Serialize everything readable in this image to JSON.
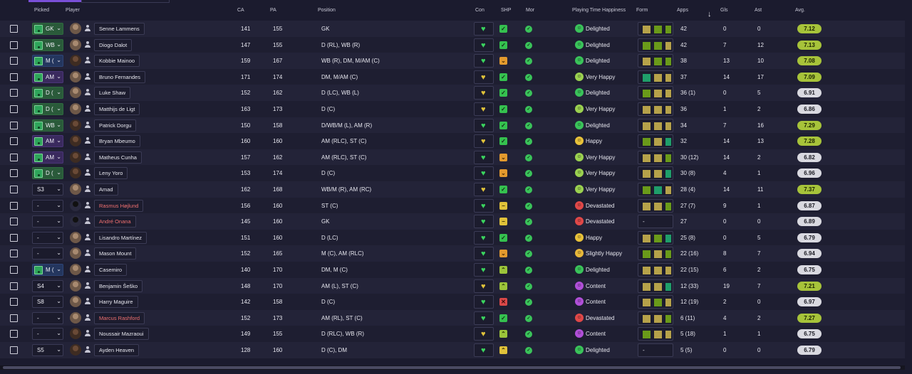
{
  "headers": {
    "picked": "Picked",
    "player": "Player",
    "ca": "CA",
    "pa": "PA",
    "position": "Position",
    "con": "Con",
    "shp": "SHP",
    "mor": "Mor",
    "pth": "Playing Time Happiness",
    "form": "Form",
    "apps": "Apps",
    "gls": "Gls",
    "ast": "Ast",
    "avg": "Avg."
  },
  "icons": {
    "checkbox": "checkbox-icon",
    "pitch": "pitch-icon",
    "chevron": "chevron-down-icon",
    "person": "person-icon",
    "heart": "heart-icon",
    "sort": "arrow-down-icon",
    "morale": "morale-icon"
  },
  "colors": {
    "accent": "#7a4fd8",
    "rating_high": "#a7c33a",
    "rating_low": "#d9d9e0",
    "negative_name": "#f07070"
  },
  "rows": [
    {
      "picked": "GK",
      "pk": "green",
      "avatar": "light",
      "name": "Senne Lammens",
      "red": false,
      "ca": "141",
      "pa": "155",
      "position": "GK",
      "con": "green",
      "shp": "green",
      "shp_g": "✓",
      "mor": "green",
      "hap": "Delighted",
      "hap_c": "g",
      "form": [
        "olive",
        "green",
        "green"
      ],
      "apps": "42",
      "gls": "0",
      "ast": "0",
      "avg": "7.12",
      "avg_hi": true
    },
    {
      "picked": "WB",
      "pk": "green",
      "avatar": "light",
      "name": "Diogo Dalot",
      "red": false,
      "ca": "147",
      "pa": "155",
      "position": "D (RL), WB (R)",
      "con": "green",
      "shp": "green",
      "shp_g": "✓",
      "mor": "green",
      "hap": "Delighted",
      "hap_c": "g",
      "form": [
        "green",
        "green",
        "olive"
      ],
      "apps": "42",
      "gls": "7",
      "ast": "12",
      "avg": "7.13",
      "avg_hi": true
    },
    {
      "picked": "M (",
      "pk": "blue",
      "avatar": "dark",
      "name": "Kobbie Mainoo",
      "red": false,
      "ca": "159",
      "pa": "167",
      "position": "WB (R), DM, M/AM (C)",
      "con": "green",
      "shp": "orange",
      "shp_g": "⌄",
      "mor": "green",
      "hap": "Delighted",
      "hap_c": "g",
      "form": [
        "olive",
        "green",
        "green"
      ],
      "apps": "38",
      "gls": "13",
      "ast": "10",
      "avg": "7.08",
      "avg_hi": true
    },
    {
      "picked": "AM",
      "pk": "purple",
      "avatar": "light",
      "name": "Bruno Fernandes",
      "red": false,
      "ca": "171",
      "pa": "174",
      "position": "DM, M/AM (C)",
      "con": "yellow",
      "shp": "green",
      "shp_g": "✓",
      "mor": "green",
      "hap": "Very Happy",
      "hap_c": "lg",
      "form": [
        "teal",
        "olive",
        "olive"
      ],
      "apps": "37",
      "gls": "14",
      "ast": "17",
      "avg": "7.09",
      "avg_hi": true
    },
    {
      "picked": "D (",
      "pk": "green",
      "avatar": "light",
      "name": "Luke Shaw",
      "red": false,
      "ca": "152",
      "pa": "162",
      "position": "D (LC), WB (L)",
      "con": "yellow",
      "shp": "green",
      "shp_g": "✓",
      "mor": "green",
      "hap": "Delighted",
      "hap_c": "g",
      "form": [
        "green",
        "olive",
        "olive"
      ],
      "apps": "36 (1)",
      "gls": "0",
      "ast": "5",
      "avg": "6.91",
      "avg_hi": false
    },
    {
      "picked": "D (",
      "pk": "green",
      "avatar": "light",
      "name": "Matthijs de Ligt",
      "red": false,
      "ca": "163",
      "pa": "173",
      "position": "D (C)",
      "con": "yellow",
      "shp": "green",
      "shp_g": "✓",
      "mor": "green",
      "hap": "Very Happy",
      "hap_c": "lg",
      "form": [
        "olive",
        "olive",
        "olive"
      ],
      "apps": "36",
      "gls": "1",
      "ast": "2",
      "avg": "6.86",
      "avg_hi": false
    },
    {
      "picked": "WB",
      "pk": "green",
      "avatar": "dark",
      "name": "Patrick Dorgu",
      "red": false,
      "ca": "150",
      "pa": "158",
      "position": "D/WB/M (L), AM (R)",
      "con": "green",
      "shp": "green",
      "shp_g": "✓",
      "mor": "green",
      "hap": "Delighted",
      "hap_c": "g",
      "form": [
        "olive",
        "olive",
        "olive"
      ],
      "apps": "34",
      "gls": "7",
      "ast": "16",
      "avg": "7.29",
      "avg_hi": true
    },
    {
      "picked": "AM",
      "pk": "purple",
      "avatar": "dark",
      "name": "Bryan Mbeumo",
      "red": false,
      "ca": "160",
      "pa": "160",
      "position": "AM (RLC), ST (C)",
      "con": "yellow",
      "shp": "green",
      "shp_g": "✓",
      "mor": "green",
      "hap": "Happy",
      "hap_c": "y",
      "form": [
        "green",
        "olive",
        "teal"
      ],
      "apps": "32",
      "gls": "14",
      "ast": "13",
      "avg": "7.28",
      "avg_hi": true
    },
    {
      "picked": "AM",
      "pk": "purple",
      "avatar": "dark",
      "name": "Matheus Cunha",
      "red": false,
      "ca": "157",
      "pa": "162",
      "position": "AM (RLC), ST (C)",
      "con": "green",
      "shp": "orange",
      "shp_g": "⌄",
      "mor": "green",
      "hap": "Very Happy",
      "hap_c": "lg",
      "form": [
        "olive",
        "olive",
        "green"
      ],
      "apps": "30 (12)",
      "gls": "14",
      "ast": "2",
      "avg": "6.82",
      "avg_hi": false
    },
    {
      "picked": "D (",
      "pk": "green",
      "avatar": "dark",
      "name": "Leny Yoro",
      "red": false,
      "ca": "153",
      "pa": "174",
      "position": "D (C)",
      "con": "green",
      "shp": "orange",
      "shp_g": "⌄",
      "mor": "green",
      "hap": "Very Happy",
      "hap_c": "lg",
      "form": [
        "olive",
        "olive",
        "teal"
      ],
      "apps": "30 (8)",
      "gls": "4",
      "ast": "1",
      "avg": "6.96",
      "avg_hi": false
    },
    {
      "picked": "S3",
      "pk": "none",
      "avatar": "light",
      "name": "Amad",
      "red": false,
      "ca": "162",
      "pa": "168",
      "position": "WB/M (R), AM (RC)",
      "con": "yellow",
      "shp": "green",
      "shp_g": "✓",
      "mor": "green",
      "hap": "Very Happy",
      "hap_c": "lg",
      "form": [
        "green",
        "teal",
        "olive"
      ],
      "apps": "28 (4)",
      "gls": "14",
      "ast": "11",
      "avg": "7.37",
      "avg_hi": true
    },
    {
      "picked": "-",
      "pk": "none",
      "avatar": "ghost",
      "name": "Rasmus Højlund",
      "red": true,
      "ca": "156",
      "pa": "160",
      "position": "ST (C)",
      "con": "green",
      "shp": "yellow",
      "shp_g": "−",
      "mor": "green",
      "hap": "Devastated",
      "hap_c": "r",
      "form": [
        "olive",
        "olive",
        "green"
      ],
      "apps": "27 (7)",
      "gls": "9",
      "ast": "1",
      "avg": "6.87",
      "avg_hi": false
    },
    {
      "picked": "-",
      "pk": "none",
      "avatar": "ghost",
      "name": "André Onana",
      "red": true,
      "ca": "145",
      "pa": "160",
      "position": "GK",
      "con": "green",
      "shp": "yellow",
      "shp_g": "−",
      "mor": "green",
      "hap": "Devastated",
      "hap_c": "r",
      "form": [
        "-"
      ],
      "apps": "27",
      "gls": "0",
      "ast": "0",
      "avg": "6.89",
      "avg_hi": false
    },
    {
      "picked": "-",
      "pk": "none",
      "avatar": "light",
      "name": "Lisandro Martínez",
      "red": false,
      "ca": "151",
      "pa": "160",
      "position": "D (LC)",
      "con": "green",
      "shp": "green",
      "shp_g": "✓",
      "mor": "green",
      "hap": "Happy",
      "hap_c": "y",
      "form": [
        "olive",
        "green",
        "teal"
      ],
      "apps": "25 (8)",
      "gls": "0",
      "ast": "5",
      "avg": "6.79",
      "avg_hi": false
    },
    {
      "picked": "-",
      "pk": "none",
      "avatar": "light",
      "name": "Mason Mount",
      "red": false,
      "ca": "152",
      "pa": "165",
      "position": "M (C), AM (RLC)",
      "con": "green",
      "shp": "orange",
      "shp_g": "⌄",
      "mor": "green",
      "hap": "Slightly Happy",
      "hap_c": "ly",
      "form": [
        "green",
        "olive",
        "green"
      ],
      "apps": "22 (16)",
      "gls": "8",
      "ast": "7",
      "avg": "6.94",
      "avg_hi": false
    },
    {
      "picked": "M (",
      "pk": "blue",
      "avatar": "light",
      "name": "Casemiro",
      "red": false,
      "ca": "140",
      "pa": "170",
      "position": "DM, M (C)",
      "con": "green",
      "shp": "lime",
      "shp_g": "⌃",
      "mor": "green",
      "hap": "Delighted",
      "hap_c": "g",
      "form": [
        "olive",
        "olive",
        "olive"
      ],
      "apps": "22 (15)",
      "gls": "6",
      "ast": "2",
      "avg": "6.75",
      "avg_hi": false
    },
    {
      "picked": "S4",
      "pk": "none",
      "avatar": "light",
      "name": "Benjamin Šeško",
      "red": false,
      "ca": "148",
      "pa": "170",
      "position": "AM (L), ST (C)",
      "con": "yellow",
      "shp": "lime",
      "shp_g": "⌃",
      "mor": "green",
      "hap": "Content",
      "hap_c": "p",
      "form": [
        "olive",
        "olive",
        "teal"
      ],
      "apps": "12 (33)",
      "gls": "19",
      "ast": "7",
      "avg": "7.21",
      "avg_hi": true
    },
    {
      "picked": "S8",
      "pk": "none",
      "avatar": "light",
      "name": "Harry Maguire",
      "red": false,
      "ca": "142",
      "pa": "158",
      "position": "D (C)",
      "con": "green",
      "shp": "red",
      "shp_g": "✕",
      "mor": "green",
      "hap": "Content",
      "hap_c": "p",
      "form": [
        "olive",
        "green",
        "olive"
      ],
      "apps": "12 (19)",
      "gls": "2",
      "ast": "0",
      "avg": "6.97",
      "avg_hi": false
    },
    {
      "picked": "-",
      "pk": "none",
      "avatar": "light",
      "name": "Marcus Rashford",
      "red": true,
      "ca": "152",
      "pa": "173",
      "position": "AM (RL), ST (C)",
      "con": "green",
      "shp": "green",
      "shp_g": "✓",
      "mor": "green",
      "hap": "Devastated",
      "hap_c": "r",
      "form": [
        "olive",
        "olive",
        "green"
      ],
      "apps": "6 (11)",
      "gls": "4",
      "ast": "2",
      "avg": "7.27",
      "avg_hi": true
    },
    {
      "picked": "-",
      "pk": "none",
      "avatar": "dark",
      "name": "Noussair Mazraoui",
      "red": false,
      "ca": "149",
      "pa": "155",
      "position": "D (RLC), WB (R)",
      "con": "yellow",
      "shp": "lime",
      "shp_g": "⌃",
      "mor": "green",
      "hap": "Content",
      "hap_c": "p",
      "form": [
        "green",
        "olive",
        "olive"
      ],
      "apps": "5 (18)",
      "gls": "1",
      "ast": "1",
      "avg": "6.75",
      "avg_hi": false
    },
    {
      "picked": "S5",
      "pk": "none",
      "avatar": "dark",
      "name": "Ayden Heaven",
      "red": false,
      "ca": "128",
      "pa": "160",
      "position": "D (C), DM",
      "con": "green",
      "shp": "yellow",
      "shp_g": "⌃",
      "mor": "green",
      "hap": "Delighted",
      "hap_c": "g",
      "form": [
        "-"
      ],
      "apps": "5 (5)",
      "gls": "0",
      "ast": "0",
      "avg": "6.79",
      "avg_hi": false
    }
  ]
}
